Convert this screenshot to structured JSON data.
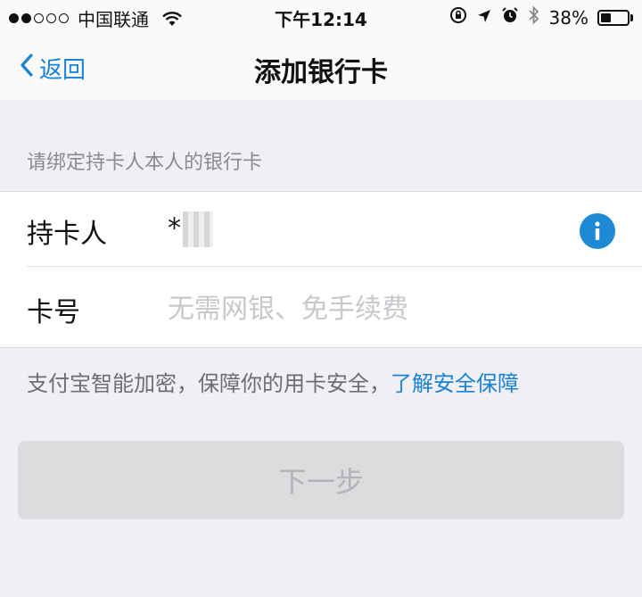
{
  "status_bar": {
    "carrier": "中国联通",
    "time": "下午12:14",
    "battery_percent": "38%",
    "battery_level": 0.38
  },
  "nav": {
    "back_label": "返回",
    "title": "添加银行卡"
  },
  "form": {
    "section_header": "请绑定持卡人本人的银行卡",
    "holder_label": "持卡人",
    "holder_value": "*",
    "card_label": "卡号",
    "card_placeholder": "无需网银、免手续费"
  },
  "security": {
    "note_text": "支付宝智能加密，保障你的用卡安全，",
    "link_text": "了解安全保障"
  },
  "actions": {
    "next_label": "下一步"
  },
  "colors": {
    "accent": "#1b82d2",
    "info_icon_bg": "#1e8ad6",
    "button_disabled_bg": "#dcdcde",
    "page_bg": "#efeff4"
  }
}
